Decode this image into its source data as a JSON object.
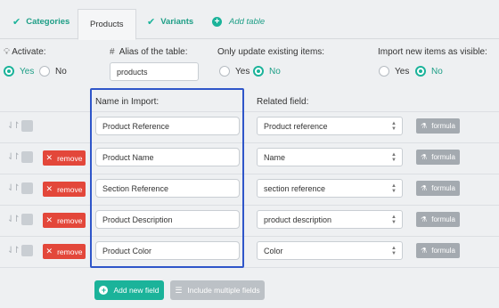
{
  "tabs": [
    {
      "label": "Categories",
      "icon": "check-icon"
    },
    {
      "label": "Products"
    },
    {
      "label": "Variants",
      "icon": "check-icon"
    },
    {
      "label": "Add table",
      "icon": "plus-circle-icon"
    }
  ],
  "options": {
    "activate": {
      "label": "Activate:",
      "yes": "Yes",
      "no": "No",
      "selected": "Yes"
    },
    "alias": {
      "label": "Alias of the table:",
      "value": "products"
    },
    "only_update": {
      "label": "Only update existing items:",
      "yes": "Yes",
      "no": "No",
      "selected": "No"
    },
    "import_visible": {
      "label": "Import new items as visible:",
      "yes": "Yes",
      "no": "No",
      "selected": "No"
    }
  },
  "columns": {
    "name": "Name in Import:",
    "related": "Related field:"
  },
  "rows": [
    {
      "name": "Product Reference",
      "related": "Product reference",
      "remove": null,
      "formula": "formula"
    },
    {
      "name": "Product Name",
      "related": "Name",
      "remove": "remove",
      "formula": "formula"
    },
    {
      "name": "Section Reference",
      "related": "section reference",
      "remove": "remove",
      "formula": "formula"
    },
    {
      "name": "Product Description",
      "related": "product description",
      "remove": "remove",
      "formula": "formula"
    },
    {
      "name": "Product Color",
      "related": "Color",
      "remove": "remove",
      "formula": "formula"
    }
  ],
  "buttons": {
    "add_field": "Add new field",
    "include_multiple": "Include multiple fields"
  },
  "colors": {
    "accent": "#1bb39a",
    "remove": "#e3473a",
    "highlight": "#2f56c9",
    "formula": "#a4aab0"
  }
}
